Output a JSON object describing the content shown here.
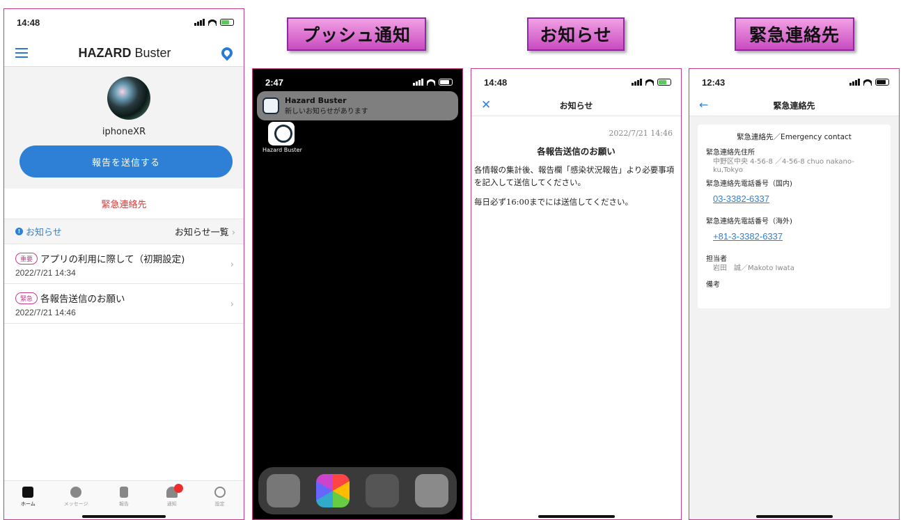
{
  "labels": {
    "push": "プッシュ通知",
    "notice": "お知らせ",
    "emergency": "緊急連絡先"
  },
  "screen_home": {
    "time": "14:48",
    "app_title_bold": "HAZARD",
    "app_title_rest": " Buster",
    "username": "iphoneXR",
    "report_button": "報告を送信する",
    "emergency_link": "緊急連絡先",
    "notice_header": "お知らせ",
    "notice_list_link": "お知らせ一覧",
    "notices": [
      {
        "tag": "重要",
        "title": "アプリの利用に際して（初期設定)",
        "date": "2022/7/21 14:34"
      },
      {
        "tag": "緊急",
        "title": "各報告送信のお願い",
        "date": "2022/7/21 14:46"
      }
    ],
    "tabs": [
      {
        "label": "ホーム",
        "icon": "home-icon"
      },
      {
        "label": "メッセージ",
        "icon": "chat-icon"
      },
      {
        "label": "報告",
        "icon": "clipboard-icon"
      },
      {
        "label": "通知",
        "icon": "bell-icon"
      },
      {
        "label": "設定",
        "icon": "gear-icon"
      }
    ],
    "accent_color": "#2e80d6",
    "alert_color": "#d14040"
  },
  "screen_push": {
    "time": "2:47",
    "app_name": "Hazard Buster",
    "message": "新しいお知らせがあります",
    "app_label": "Hazard Buster",
    "dock": [
      "camera-icon",
      "photos-icon",
      "app-folder-icon",
      "settings-icon"
    ]
  },
  "screen_notice": {
    "time": "14:48",
    "title": "お知らせ",
    "datetime": "2022/7/21 14:46",
    "heading": "各報告送信のお願い",
    "body1": "各情報の集計後、報告欄「感染状況報告」より必要事項を記入して送信してください。",
    "body2": "毎日必ず16:00までには送信してください。"
  },
  "screen_emergency": {
    "time": "12:43",
    "title": "緊急連絡先",
    "card_heading": "緊急連絡先／Emergency contact",
    "address_label": "緊急連絡先住所",
    "address_value": "中野区中央 4-56-8 ／4-56-8 chuo nakano-ku,Tokyo",
    "phone_domestic_label": "緊急連絡先電話番号（国内)",
    "phone_domestic": "03-3382-6337",
    "phone_overseas_label": "緊急連絡先電話番号（海外)",
    "phone_overseas": "+81-3-3382-6337",
    "person_label": "担当者",
    "person_value": "岩田　誠／Makoto Iwata",
    "notes_label": "備考"
  }
}
